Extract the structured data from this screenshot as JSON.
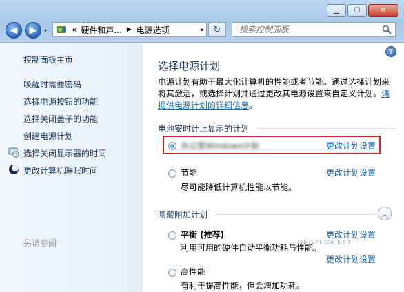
{
  "titlebar": {
    "window_buttons": {
      "minimize": "▁",
      "maximize": "☐",
      "close": "✕"
    },
    "nav": {
      "back": "◀",
      "forward": "▶",
      "history": "▾"
    },
    "address": {
      "overflow": "«",
      "segments": [
        "硬件和声...",
        "电源选项"
      ],
      "separator": "▶",
      "dropdown": "▾"
    },
    "refresh": "↻",
    "search": {
      "placeholder": "搜索控制面板"
    }
  },
  "sidebar": {
    "home": "控制面板主页",
    "items": [
      {
        "label": "唤醒时需要密码",
        "icon": null
      },
      {
        "label": "选择电源按钮的功能",
        "icon": null
      },
      {
        "label": "选择关闭盖子的功能",
        "icon": null
      },
      {
        "label": "创建电源计划",
        "icon": null
      },
      {
        "label": "选择关闭显示器的时间",
        "icon": "display-clock-icon"
      },
      {
        "label": "更改计算机睡眠时间",
        "icon": "moon-icon"
      }
    ],
    "see_also": "另请参阅"
  },
  "main": {
    "help": "?",
    "heading": "选择电源计划",
    "description": "电源计划有助于最大化计算机的性能或者节能。通过选择计划来将其激活，或选择计划并通过更改其电源设置来自定义计划。",
    "description_link": "请提供电源计划的详细信息",
    "description_end": "。",
    "battery_group": {
      "title": "电池安时计上显示的计划",
      "plans": [
        {
          "name": "办公室Windows计划",
          "selected": true,
          "blurred": true,
          "link": "更改计划设置"
        },
        {
          "name": "节能",
          "selected": false,
          "desc": "尽可能降低计算机性能以节能。",
          "link": "更改计划设置"
        }
      ]
    },
    "hidden_group": {
      "title": "隐藏附加计划",
      "collapse": "︿",
      "plans": [
        {
          "name": "平衡 (推荐)",
          "selected": false,
          "desc": "利用可用的硬件自动平衡功耗与性能。",
          "link": "更改计划设置"
        },
        {
          "name": "高性能",
          "selected": false,
          "desc": "有利于提高性能，但会增加功耗。",
          "link": "更改计划设置"
        }
      ]
    },
    "watermark": "ONGZHUA.NET"
  },
  "colors": {
    "accent_link": "#0b64c0",
    "highlight_border": "#d42428",
    "sidebar_bg": "#e6eff9"
  }
}
